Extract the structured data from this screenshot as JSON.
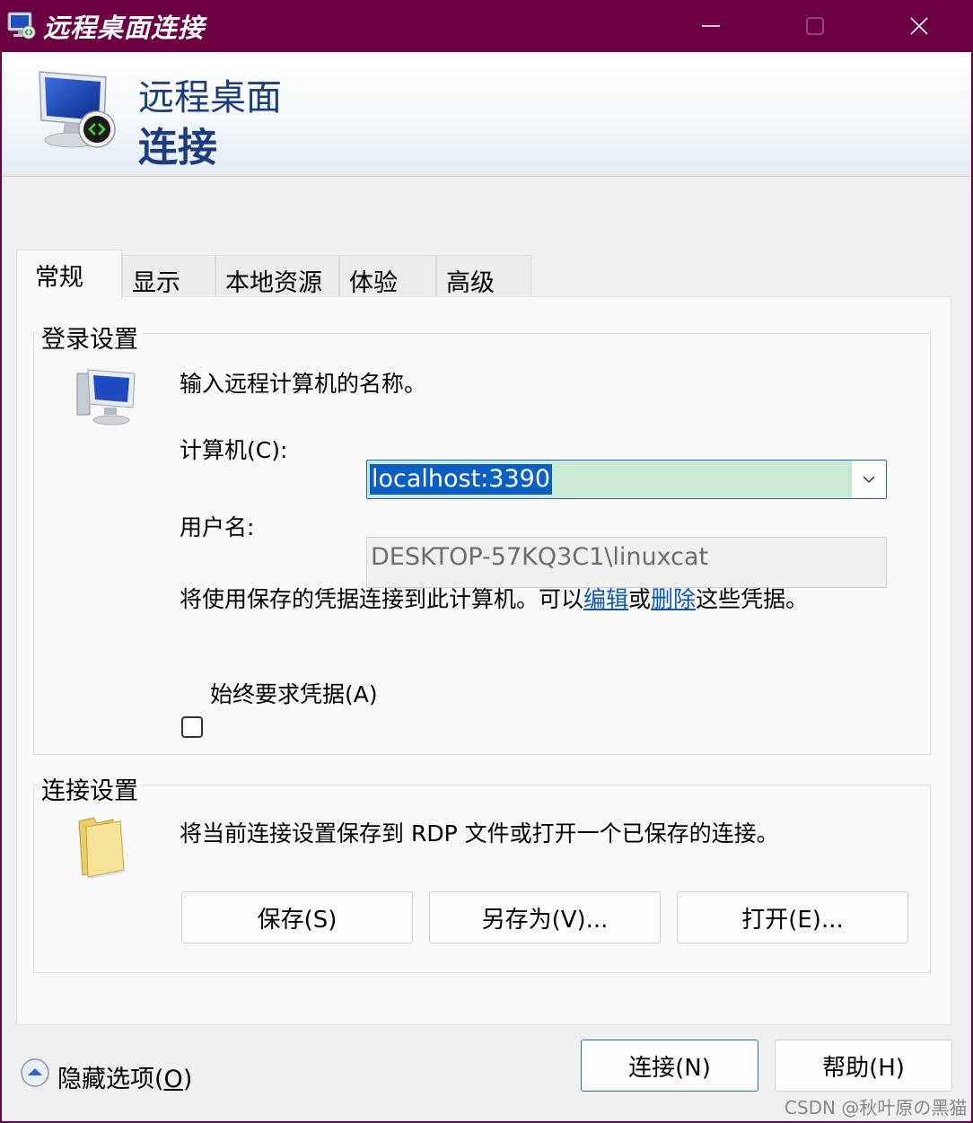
{
  "window": {
    "title": "远程桌面连接"
  },
  "banner": {
    "line1": "远程桌面",
    "line2": "连接"
  },
  "tabs": [
    {
      "label": "常规",
      "active": true
    },
    {
      "label": "显示",
      "active": false
    },
    {
      "label": "本地资源",
      "active": false
    },
    {
      "label": "体验",
      "active": false
    },
    {
      "label": "高级",
      "active": false
    }
  ],
  "login_settings": {
    "legend": "登录设置",
    "intro": "输入远程计算机的名称。",
    "computer_label": "计算机(C):",
    "computer_value": "localhost:3390",
    "username_label": "用户名:",
    "username_value": "DESKTOP-57KQ3C1\\linuxcat",
    "note_before": "将使用保存的凭据连接到此计算机。可以",
    "note_link_edit": "编辑",
    "note_middle": "或",
    "note_link_delete": "删除",
    "note_after": "这些凭据。",
    "checkbox_label": "始终要求凭据(A)",
    "checkbox_checked": false
  },
  "connection_settings": {
    "legend": "连接设置",
    "description": "将当前连接设置保存到 RDP 文件或打开一个已保存的连接。",
    "save_label": "保存(S)",
    "save_as_label": "另存为(V)...",
    "open_label": "打开(E)..."
  },
  "footer": {
    "hide_options_prefix": "隐藏选项(",
    "hide_options_accel": "O",
    "hide_options_suffix": ")",
    "connect_label": "连接(N)",
    "help_label": "帮助(H)"
  },
  "watermark": "CSDN @秋叶原の黑猫",
  "colors": {
    "titlebar": "#6b0042",
    "banner_text": "#1d3c7e",
    "selection": "#0b5fc2",
    "combo_bg": "#c9e9d3",
    "link": "#0a55b8"
  }
}
